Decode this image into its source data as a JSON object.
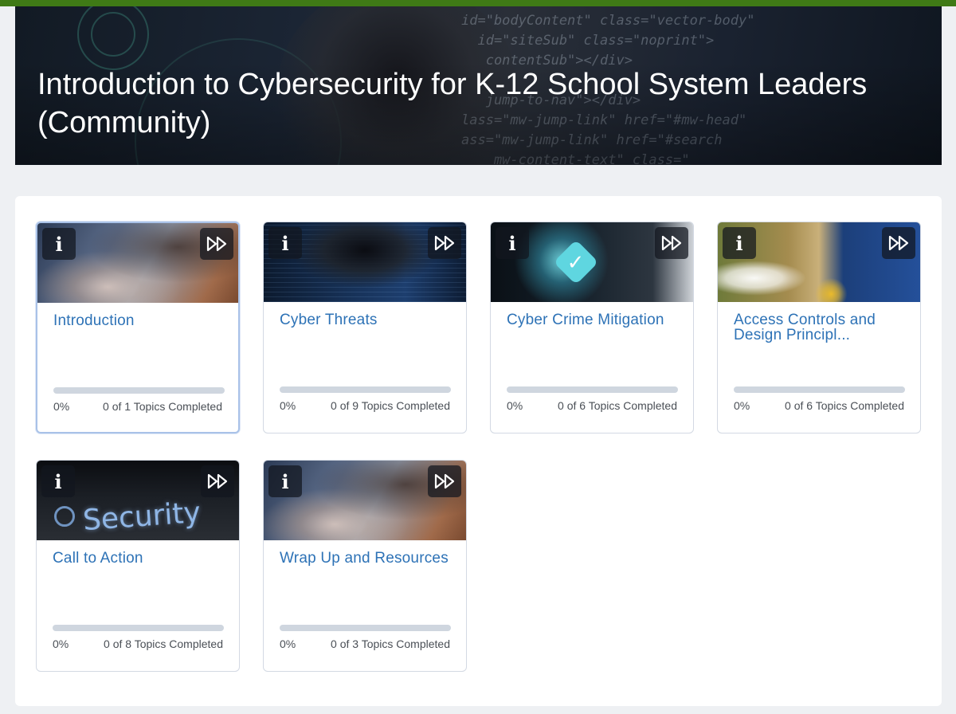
{
  "course": {
    "title": "Introduction to Cybersecurity for K-12 School System Leaders (Community)"
  },
  "banner": {
    "code_lines": [
      "id=\"bodyContent\" class=\"vector-body\"",
      "  id=\"siteSub\" class=\"noprint\">",
      "   contentSub\"></div>",
      "",
      "   jump-to-nav\"></div>",
      "lass=\"mw-jump-link\" href=\"#mw-head\"",
      "ass=\"mw-jump-link\" href=\"#search",
      "    mw-content-text\" class=\""
    ]
  },
  "colors": {
    "accent_green": "#3f7a16",
    "link_blue": "#2d72b6",
    "focus_border": "#a9c2e8"
  },
  "units": [
    {
      "title": "Introduction",
      "percent_label": "0%",
      "progress": 0,
      "completed_label": "0 of 1 Topics Completed",
      "image": "hands-typing-laptop",
      "focused": true
    },
    {
      "title": "Cyber Threats",
      "percent_label": "0%",
      "progress": 0,
      "completed_label": "0 of 9 Topics Completed",
      "image": "hooded-hacker-code",
      "focused": false
    },
    {
      "title": "Cyber Crime Mitigation",
      "percent_label": "0%",
      "progress": 0,
      "completed_label": "0 of 6 Topics Completed",
      "image": "shield-checkmark-network",
      "focused": false
    },
    {
      "title": "Access Controls and Design Principl...",
      "percent_label": "0%",
      "progress": 0,
      "completed_label": "0 of 6 Topics Completed",
      "image": "laptop-login-lock",
      "focused": false
    },
    {
      "title": "Call to Action",
      "percent_label": "0%",
      "progress": 0,
      "completed_label": "0 of 8 Topics Completed",
      "image": "security-word-screen",
      "focused": false
    },
    {
      "title": "Wrap Up and Resources",
      "percent_label": "0%",
      "progress": 0,
      "completed_label": "0 of 3 Topics Completed",
      "image": "hands-typing-laptop",
      "focused": false
    }
  ],
  "icons": {
    "info": "info-icon",
    "fast_forward": "fast-forward-icon"
  },
  "thumb_text": {
    "security": "Security"
  }
}
